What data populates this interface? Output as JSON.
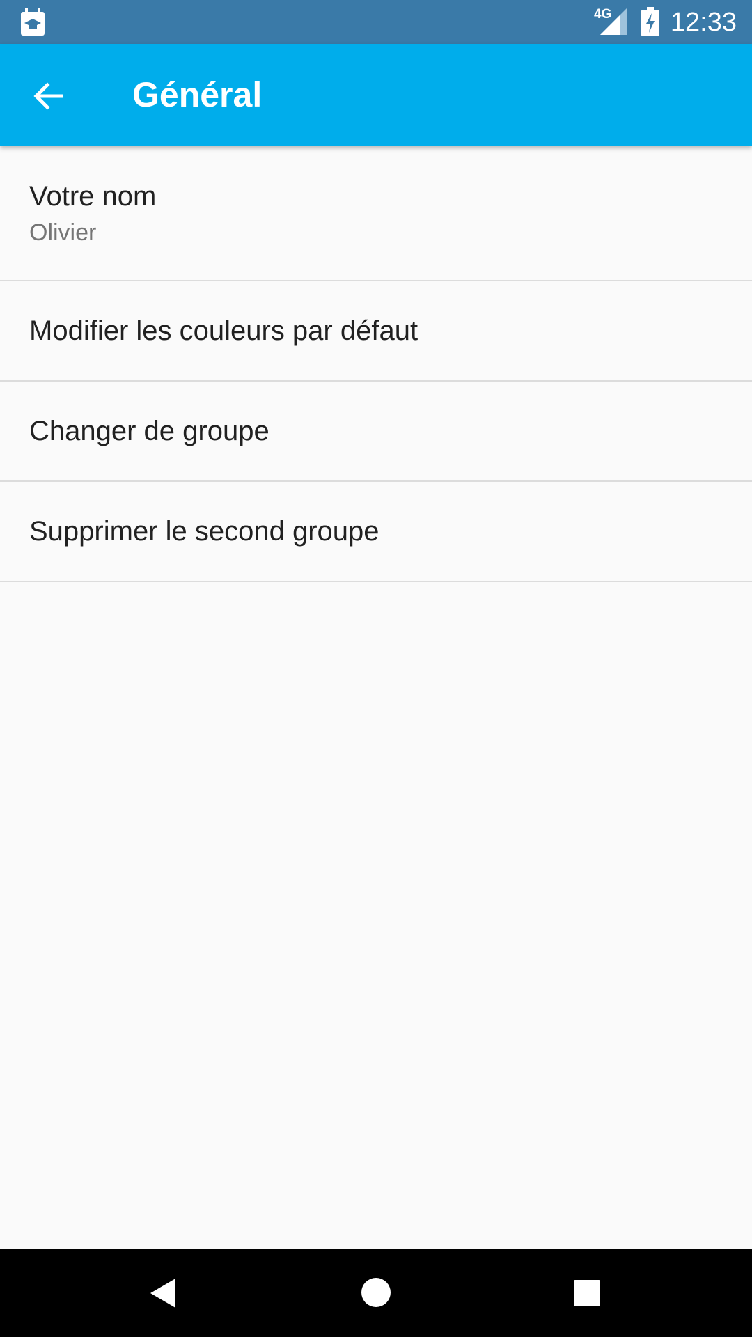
{
  "status_bar": {
    "network": "4G",
    "time": "12:33",
    "app_icon": "calendar-graduation-icon",
    "signal_icon": "cell-signal-icon",
    "battery_icon": "battery-charging-icon",
    "background_color": "#3a7aa8"
  },
  "app_bar": {
    "title": "Général",
    "back_icon": "arrow-left-icon",
    "background_color": "#00adeb"
  },
  "settings": {
    "items": [
      {
        "label": "Votre nom",
        "summary": "Olivier"
      },
      {
        "label": "Modifier les couleurs par défaut"
      },
      {
        "label": "Changer de groupe"
      },
      {
        "label": "Supprimer le second groupe"
      }
    ]
  },
  "nav_bar": {
    "back_icon": "triangle-back-icon",
    "home_icon": "circle-home-icon",
    "recent_icon": "square-recent-icon"
  }
}
